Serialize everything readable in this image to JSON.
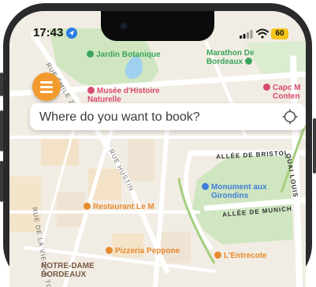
{
  "status_bar": {
    "time": "17:43",
    "battery": "60",
    "icons": [
      "location-arrow-icon",
      "cellular-signal-icon",
      "wifi-icon",
      "battery-icon"
    ]
  },
  "menu_button": {
    "icon": "hamburger-menu-icon",
    "color": "#f29a2e"
  },
  "search": {
    "placeholder": "Where do you want to book?",
    "icon": "locate-crosshair-icon"
  },
  "map": {
    "pois": [
      {
        "label": "Jardin Botanique",
        "color": "#3aa55a"
      },
      {
        "label": "Musée d'Histoire\nNaturelle",
        "color": "#d84a6b"
      },
      {
        "label": "Marathon De\nBordeaux",
        "color": "#3aa55a"
      },
      {
        "label": "Capc M\nConten",
        "color": "#d84a6b"
      },
      {
        "label": "Monument aux\nGirondins",
        "color": "#3f7fd6"
      },
      {
        "label": "Restaurant Le M",
        "color": "#e8892e"
      },
      {
        "label": "Pizzeria Peppone",
        "color": "#e8892e"
      },
      {
        "label": "L'Entrecote",
        "color": "#e8892e"
      },
      {
        "label": "NOTRE-DAME\nBORDEAUX",
        "color": "#7a5a44"
      }
    ],
    "streets": [
      "RUE ÉMILE ZOLA",
      "RUE HUSTIN",
      "RUE DE LA VIEILLE TOUR",
      "ALLÉE DE BRISTOL",
      "ALLÉE DE MUNICH",
      "QUAI LOUIS"
    ]
  }
}
